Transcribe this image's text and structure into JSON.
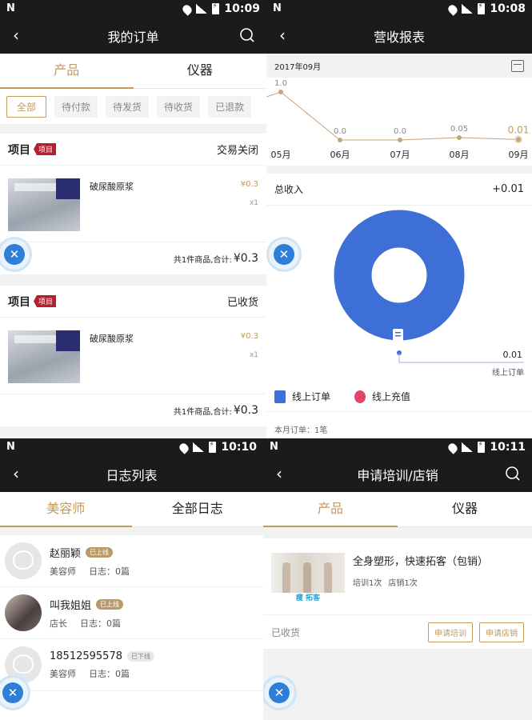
{
  "status_bars": [
    {
      "n": "N",
      "time": "10:09"
    },
    {
      "n": "N",
      "time": "10:08"
    },
    {
      "n": "N",
      "time": "10:10"
    },
    {
      "n": "N",
      "time": "10:11"
    }
  ],
  "orders": {
    "title": "我的订单",
    "tabs": [
      "产品",
      "仪器"
    ],
    "filters": [
      "全部",
      "待付款",
      "待发货",
      "待收货",
      "已退款"
    ],
    "items": [
      {
        "type": "项目",
        "tag": "项目",
        "status": "交易关闭",
        "product": "破尿酸原浆",
        "price": "¥0.3",
        "qty": "x1",
        "summary": "共1件商品,合计:",
        "total": "¥0.3"
      },
      {
        "type": "项目",
        "tag": "项目",
        "status": "已收货",
        "product": "破尿酸原浆",
        "price": "¥0.3",
        "qty": "x1",
        "summary": "共1件商品,合计:",
        "total": "¥0.3"
      }
    ]
  },
  "report": {
    "title": "营收报表",
    "date": "2017年09月",
    "total_label": "总收入",
    "total_value": "+0.01",
    "donut_value": "0.01",
    "donut_label": "线上订单",
    "legend": [
      "线上订单",
      "线上充值"
    ],
    "cut_text": "本月订单：1笔"
  },
  "chart_data": {
    "type": "line",
    "categories": [
      "05月",
      "06月",
      "07月",
      "08月",
      "09月"
    ],
    "values": [
      1.0,
      0.0,
      0.0,
      0.05,
      0.01
    ],
    "value_labels": [
      "1.0",
      "0.0",
      "0.0",
      "0.05",
      "0.01"
    ],
    "line_color": "#c7a57a",
    "highlight_color": "#c49a5a"
  },
  "logs": {
    "title": "日志列表",
    "tabs": [
      "美容师",
      "全部日志"
    ],
    "items": [
      {
        "name": "赵丽颖",
        "badge": "已上线",
        "role": "美容师",
        "log": "日志：0篇",
        "online": true
      },
      {
        "name": "叫我姐姐",
        "badge": "已上线",
        "role": "店长",
        "log": "日志：0篇",
        "online": true
      },
      {
        "name": "18512595578",
        "badge": "已下线",
        "role": "美容师",
        "log": "日志：0篇",
        "online": false
      }
    ]
  },
  "apply": {
    "title": "申请培训/店销",
    "tabs": [
      "产品",
      "仪器"
    ],
    "card": {
      "title": "全身塑形，快速拓客（包销）",
      "training": "培训1次",
      "sales": "店销1次",
      "status": "已收货",
      "btn_training": "申请培训",
      "btn_sales": "申请店销",
      "thumb_text": "瘦  拓客"
    }
  },
  "colors": {
    "accent": "#c49a5a",
    "donut": "#3d6fd6",
    "tag": "#b52031"
  }
}
